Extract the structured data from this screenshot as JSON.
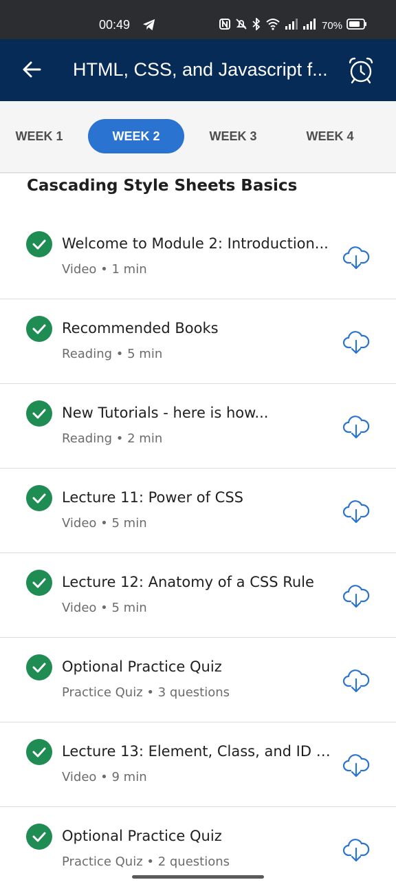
{
  "status_bar": {
    "time": "00:49",
    "battery": "70%",
    "icons": [
      "telegram-icon",
      "nfc-icon",
      "mute-icon",
      "bluetooth-icon",
      "wifi-icon",
      "signal-icon",
      "signal-icon",
      "battery-icon"
    ]
  },
  "app_bar": {
    "title": "HTML, CSS, and Javascript f...",
    "back_icon": "back-arrow-icon",
    "alarm_icon": "alarm-clock-icon"
  },
  "weeks": [
    {
      "label": "WEEK 1",
      "active": false
    },
    {
      "label": "WEEK 2",
      "active": true
    },
    {
      "label": "WEEK 3",
      "active": false
    },
    {
      "label": "WEEK 4",
      "active": false
    }
  ],
  "section_title": "Cascading Style Sheets Basics",
  "items": [
    {
      "title": "Welcome to Module 2: Introduction...",
      "meta": "Video • 1 min"
    },
    {
      "title": "Recommended Books",
      "meta": "Reading • 5 min"
    },
    {
      "title": "New Tutorials - here is how...",
      "meta": "Reading • 2 min"
    },
    {
      "title": "Lecture 11: Power of CSS",
      "meta": "Video • 5 min"
    },
    {
      "title": "Lecture 12: Anatomy of a CSS Rule",
      "meta": "Video • 5 min"
    },
    {
      "title": "Optional Practice Quiz",
      "meta": "Practice Quiz • 3 questions"
    },
    {
      "title": "Lecture 13: Element, Class, and ID S...",
      "meta": "Video • 9 min"
    },
    {
      "title": "Optional Practice Quiz",
      "meta": "Practice Quiz • 2 questions"
    }
  ],
  "colors": {
    "app_bar": "#062b57",
    "active_tab": "#2a73d0",
    "check": "#1e8c53",
    "download": "#2a73d0"
  }
}
